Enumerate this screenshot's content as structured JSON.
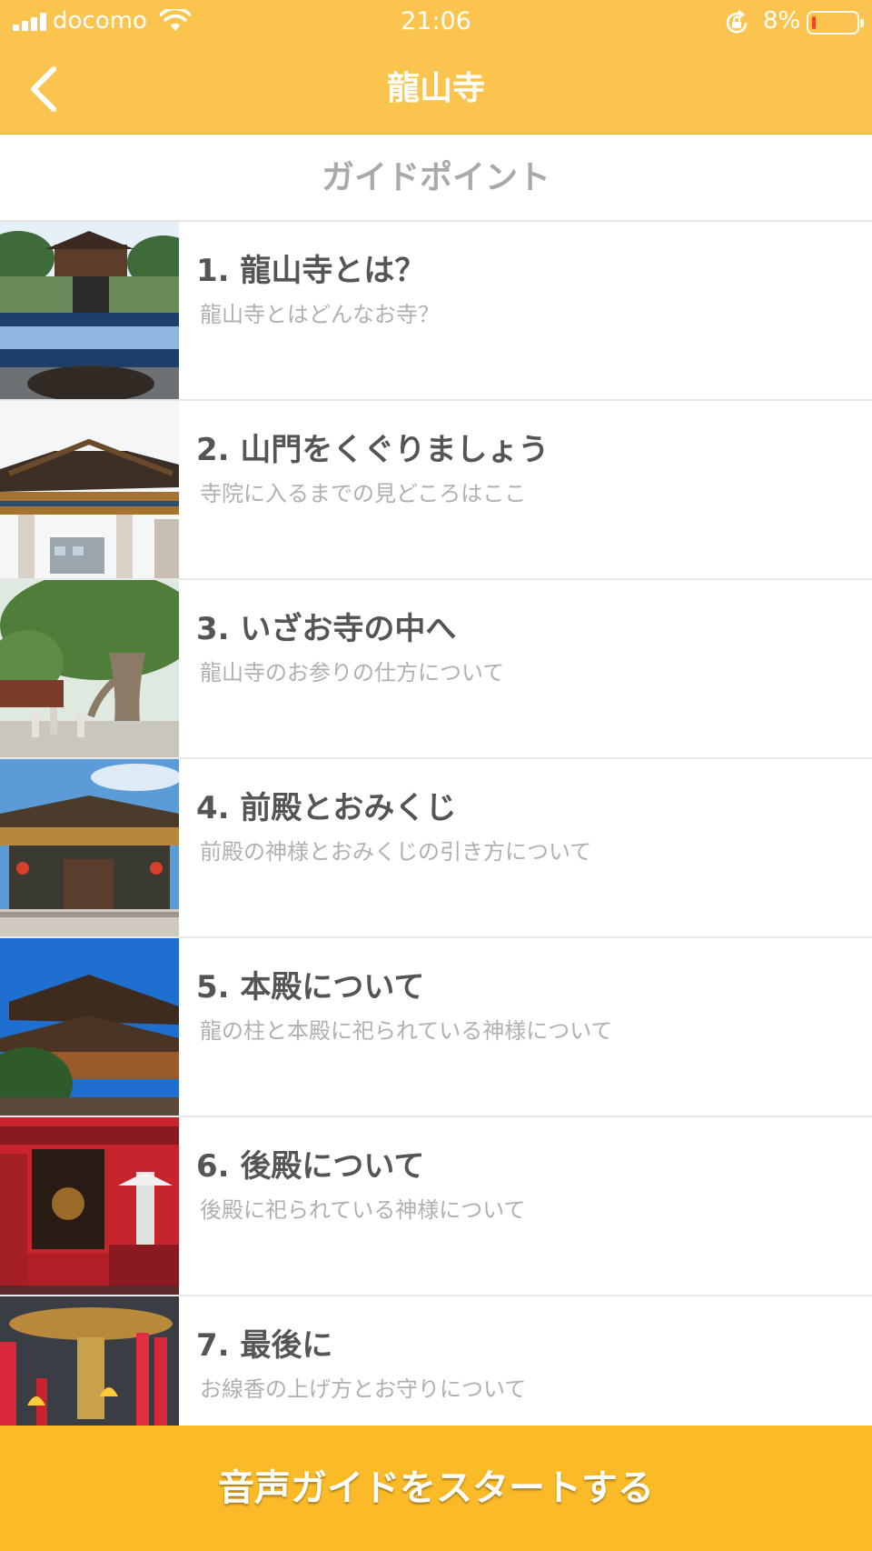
{
  "status_bar": {
    "carrier": "docomo",
    "time": "21:06",
    "battery_percent": "8%",
    "battery_level": 0.08
  },
  "nav": {
    "title": "龍山寺",
    "back_icon": "chevron-left-icon"
  },
  "section": {
    "title": "ガイドポイント"
  },
  "guide_points": [
    {
      "title": "1. 龍山寺とは？",
      "subtitle": "龍山寺とはどんなお寺？",
      "thumbnail": "temple-courtyard-photo"
    },
    {
      "title": "2. 山門をくぐりましょう",
      "subtitle": "寺院に入るまでの見どころはここ",
      "thumbnail": "temple-gate-photo"
    },
    {
      "title": "3. いざお寺の中へ",
      "subtitle": "龍山寺のお参りの仕方について",
      "thumbnail": "banyan-tree-photo"
    },
    {
      "title": "4. 前殿とおみくじ",
      "subtitle": "前殿の神様とおみくじの引き方について",
      "thumbnail": "front-hall-photo"
    },
    {
      "title": "5. 本殿について",
      "subtitle": "龍の柱と本殿に祀られている神様について",
      "thumbnail": "main-hall-photo"
    },
    {
      "title": "6. 後殿について",
      "subtitle": "後殿に祀られている神様について",
      "thumbnail": "rear-hall-photo"
    },
    {
      "title": "7. 最後に",
      "subtitle": "お線香の上げ方とお守りについて",
      "thumbnail": "incense-burner-photo"
    }
  ],
  "start_button": {
    "label": "音声ガイドをスタートする"
  },
  "colors": {
    "header": "#fbc44e",
    "start_button": "#fbba27",
    "title_text": "#555555",
    "subtitle_text": "#b0b0b0"
  }
}
